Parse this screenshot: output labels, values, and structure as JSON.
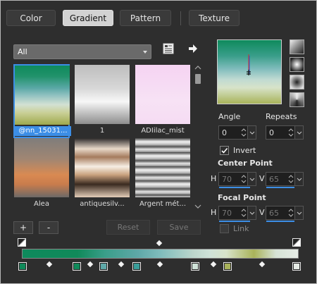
{
  "tabs": [
    {
      "label": "Color"
    },
    {
      "label": "Gradient"
    },
    {
      "label": "Pattern"
    },
    {
      "label": "Texture"
    }
  ],
  "category_select": {
    "value": "All"
  },
  "thumbnails": [
    {
      "label": "@nn_15031..."
    },
    {
      "label": "1"
    },
    {
      "label": "ADIilac_mist"
    },
    {
      "label": "Alea"
    },
    {
      "label": "antiquesilv..."
    },
    {
      "label": "Argent mét..."
    }
  ],
  "buttons": {
    "add": "+",
    "remove": "-",
    "reset": "Reset",
    "save": "Save"
  },
  "options": {
    "angle_label": "Angle",
    "angle_value": "0",
    "repeats_label": "Repeats",
    "repeats_value": "0",
    "invert_label": "Invert",
    "invert_checked": true,
    "center_point_label": "Center Point",
    "center_h_label": "H",
    "center_h_value": "70",
    "center_v_label": "V",
    "center_v_value": "65",
    "focal_point_label": "Focal Point",
    "focal_h_label": "H",
    "focal_h_value": "70",
    "focal_v_label": "V",
    "focal_v_value": "65",
    "link_label": "Link"
  },
  "colors": {
    "accent": "#3c8ee6",
    "green": "#108a5a",
    "teal": "#5fa8a8",
    "pale": "#cfe2d8",
    "olive": "#a9b35a"
  },
  "icons": {
    "library": "library-icon",
    "arrow": "arrow-right-icon"
  }
}
